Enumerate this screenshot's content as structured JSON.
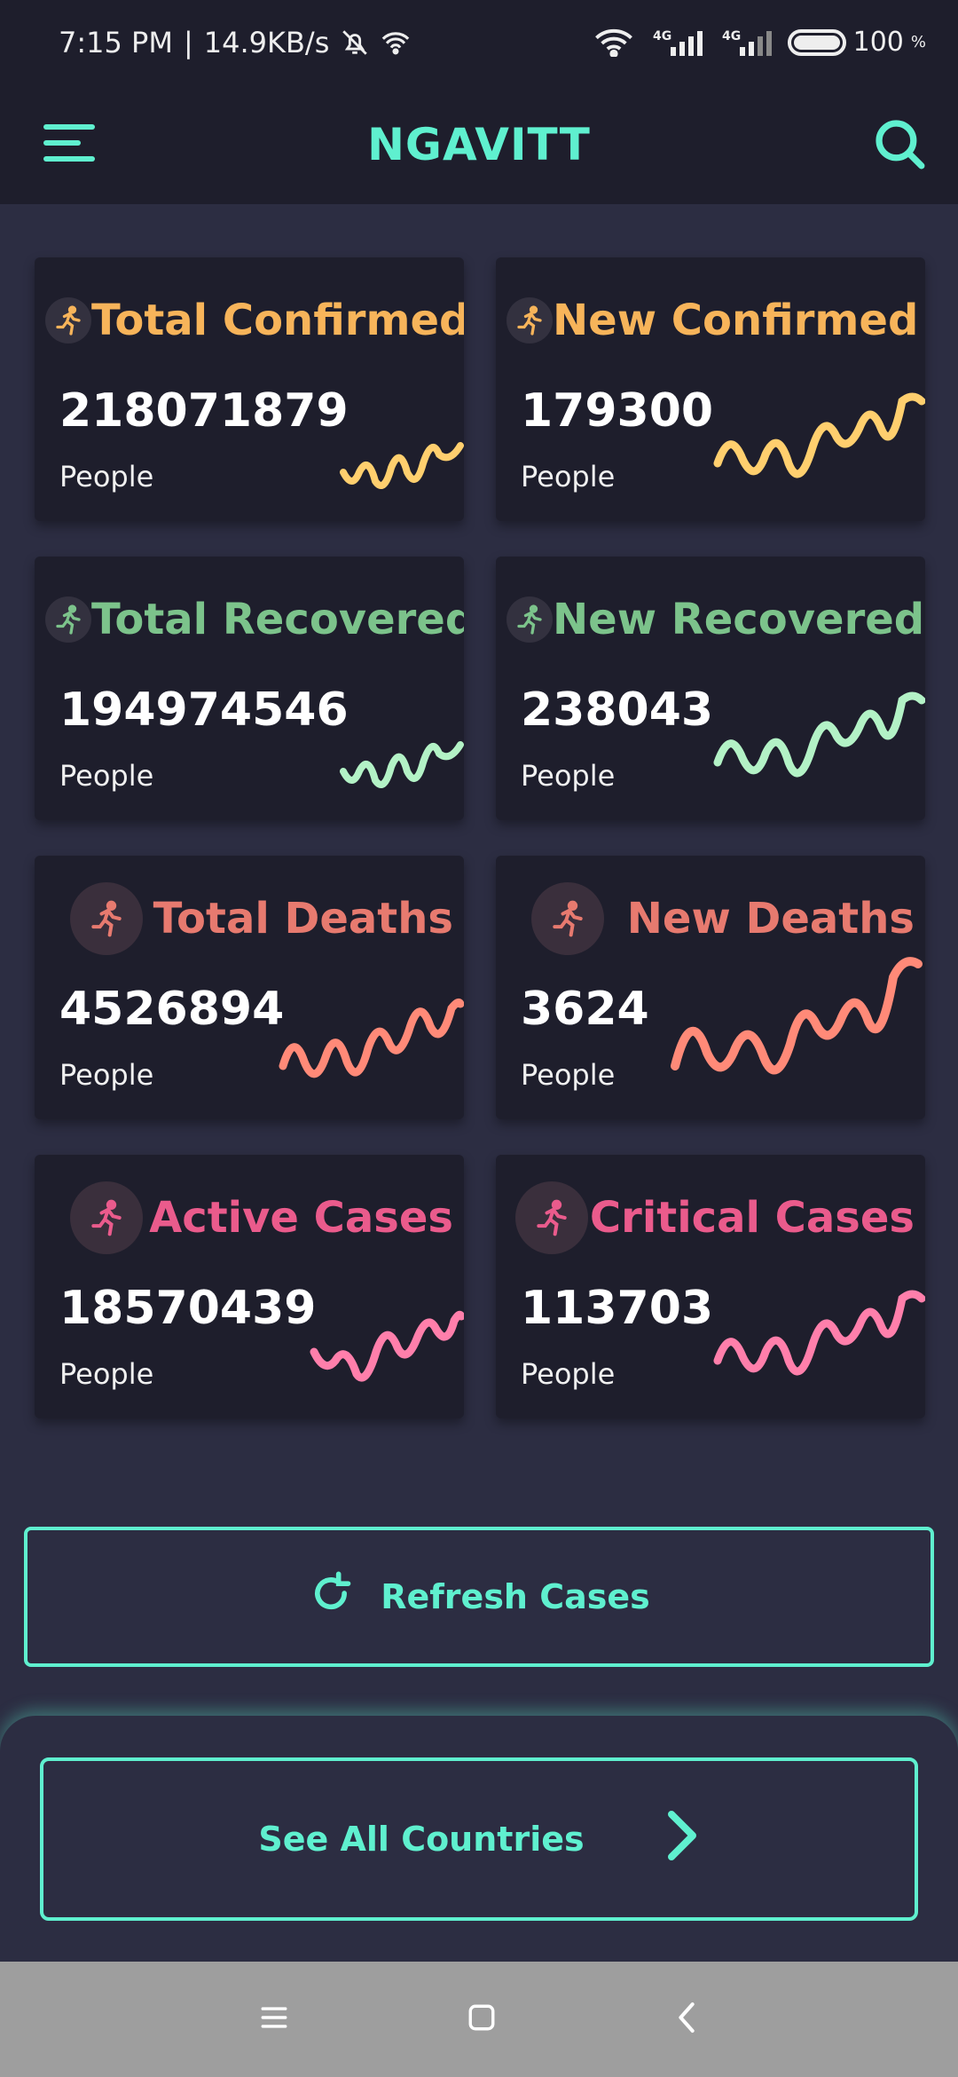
{
  "status_bar": {
    "time": "7:15 PM",
    "separator": "|",
    "speed": "14.9KB/s",
    "battery": "100",
    "battery_unit": "%",
    "network_1": "4G",
    "network_2": "4G"
  },
  "app_bar": {
    "title": "NGAVITT",
    "menu_icon": "hamburger-icon",
    "search_icon": "search-icon"
  },
  "colors": {
    "accent": "#5ff0cf",
    "confirmed": "#f7b45a",
    "recovered": "#7cc38b",
    "deaths": "#e77a6f",
    "active": "#ea5b8c",
    "background": "#2c2d42",
    "card": "#1e1e2c"
  },
  "cards": [
    {
      "title": "Total Confirmed",
      "value": "218071879",
      "unit": "People",
      "color": "#f7b45a",
      "spark": "#ffcf6e",
      "icon": "running-person-icon"
    },
    {
      "title": "New Confirmed",
      "value": "179300",
      "unit": "People",
      "color": "#f7b45a",
      "spark": "#ffcf6e",
      "icon": "running-person-icon"
    },
    {
      "title": "Total Recovered",
      "value": "194974546",
      "unit": "People",
      "color": "#7cc38b",
      "spark": "#b3f2c6",
      "icon": "running-person-icon"
    },
    {
      "title": "New Recovered",
      "value": "238043",
      "unit": "People",
      "color": "#7cc38b",
      "spark": "#b3f2c6",
      "icon": "running-person-icon"
    },
    {
      "title": "Total Deaths",
      "value": "4526894",
      "unit": "People",
      "color": "#e77a6f",
      "spark": "#ff8a78",
      "icon": "running-person-icon"
    },
    {
      "title": "New Deaths",
      "value": "3624",
      "unit": "People",
      "color": "#e77a6f",
      "spark": "#ff8a78",
      "icon": "running-person-icon"
    },
    {
      "title": "Active Cases",
      "value": "18570439",
      "unit": "People",
      "color": "#ea5b8c",
      "spark": "#ff7fab",
      "icon": "running-person-icon"
    },
    {
      "title": "Critical Cases",
      "value": "113703",
      "unit": "People",
      "color": "#ea5b8c",
      "spark": "#ff7fab",
      "icon": "running-person-icon"
    }
  ],
  "refresh_button": {
    "label": "Refresh Cases",
    "icon": "refresh-icon"
  },
  "countries_button": {
    "label": "See All Countries",
    "icon": "chevron-right-icon"
  },
  "nav_bar": {
    "items": [
      "menu-icon",
      "home-icon",
      "back-icon"
    ]
  }
}
